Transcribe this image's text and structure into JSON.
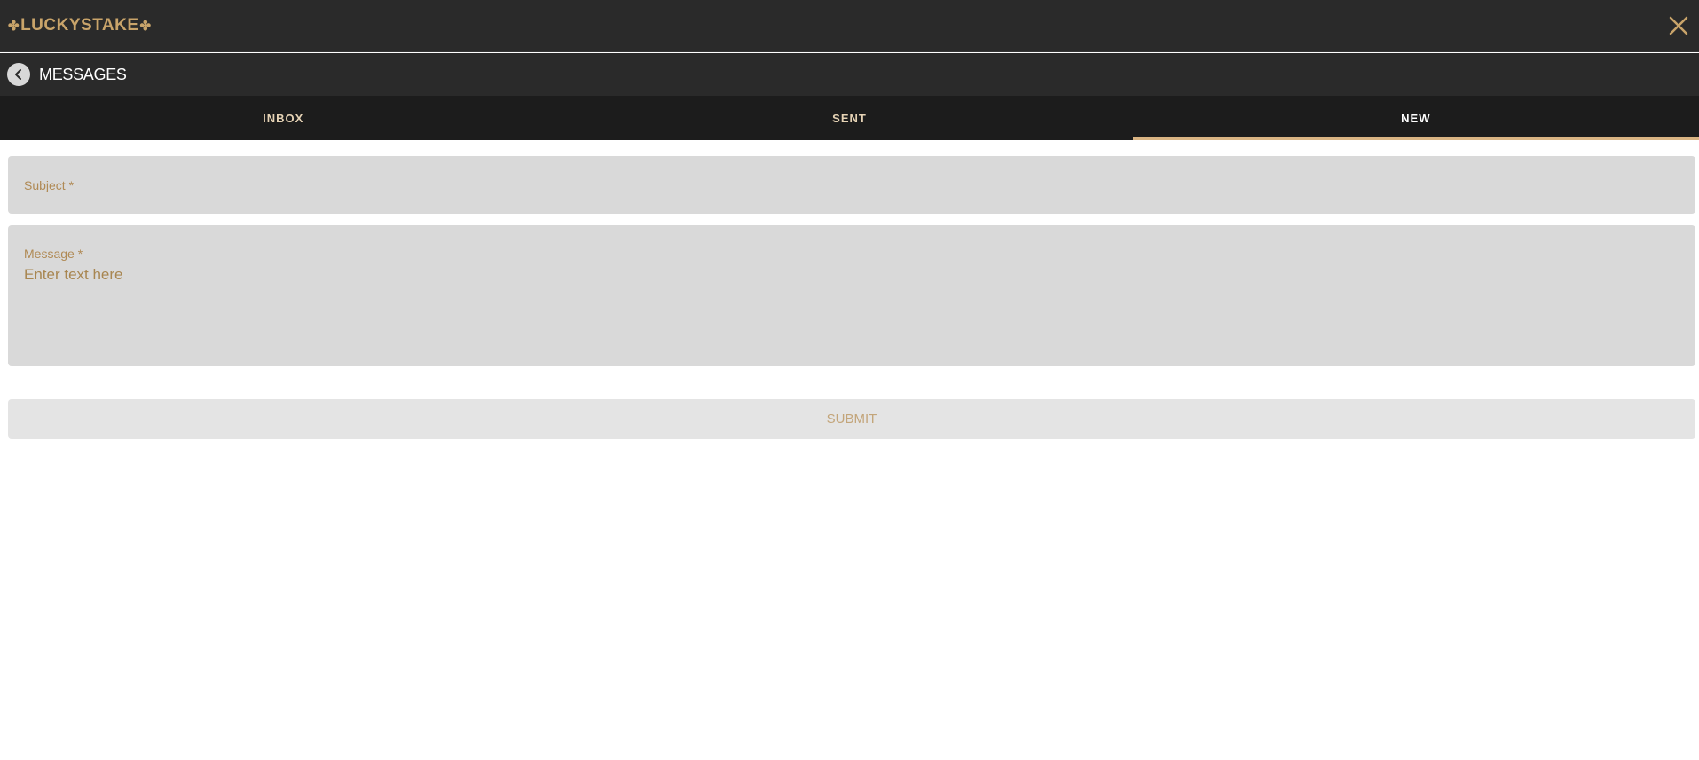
{
  "brand": {
    "logo_text": "LUCKYSTAKE",
    "logo_prefix_icon": "clover-icon",
    "logo_suffix_icon": "clover-icon",
    "color": "#c9a46a"
  },
  "topbar": {
    "close_icon": "close-icon"
  },
  "header": {
    "back_icon": "chevron-left-icon",
    "title": "MESSAGES"
  },
  "tabs": [
    {
      "label": "INBOX",
      "active": false
    },
    {
      "label": "SENT",
      "active": false
    },
    {
      "label": "NEW",
      "active": true
    }
  ],
  "form": {
    "subject": {
      "label": "Subject *",
      "value": ""
    },
    "message": {
      "label": "Message *",
      "placeholder": "Enter text here",
      "value": ""
    },
    "submit_label": "SUBMIT"
  },
  "colors": {
    "accent": "#d9b483",
    "topbar_bg": "#2a2a2a",
    "tabs_bg": "#1c1c1c",
    "field_bg": "#d9d9d9",
    "label": "#b08a55"
  }
}
